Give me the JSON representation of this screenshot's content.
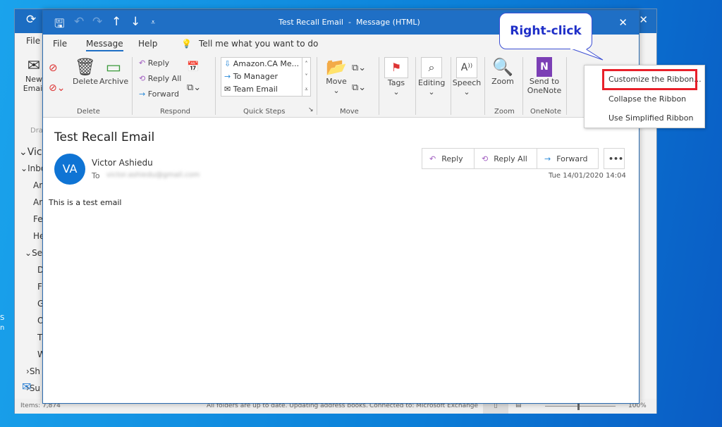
{
  "desktop": {
    "left_fragments": [
      "S",
      "n"
    ]
  },
  "main_window": {
    "tab_file": "File",
    "new_email": "New Email",
    "drafts": "Dra",
    "folders": [
      "Vic",
      "Inbo",
      "An",
      "An",
      "Fe",
      "He",
      "Se",
      "D",
      "F",
      "G",
      "O",
      "T",
      "W",
      "Sh",
      "Su"
    ],
    "status": {
      "items": "Items: 7,874",
      "sync": "All folders are up to date.  Updating address books.",
      "connection": "Connected to: Microsoft Exchange",
      "zoom": "100%"
    }
  },
  "message_window": {
    "title": "Test Recall Email  -  Message (HTML)",
    "tabs": [
      {
        "label": "File"
      },
      {
        "label": "Message",
        "active": true
      },
      {
        "label": "Help"
      }
    ],
    "tell_me": "Tell me what you want to do",
    "ribbon": {
      "delete_group": {
        "label": "Delete",
        "delete": "Delete",
        "archive": "Archive"
      },
      "respond_group": {
        "label": "Respond",
        "reply": "Reply",
        "reply_all": "Reply All",
        "forward": "Forward"
      },
      "quick_steps": {
        "label": "Quick Steps",
        "items": [
          "Amazon.CA Me...",
          "To Manager",
          "Team Email"
        ]
      },
      "move_group": {
        "label": "Move",
        "move": "Move"
      },
      "tags": "Tags",
      "editing": "Editing",
      "speech": "Speech",
      "zoom_group": {
        "label": "Zoom",
        "zoom": "Zoom"
      },
      "onenote_group": {
        "label": "OneNote",
        "send": "Send to OneNote"
      }
    },
    "email": {
      "subject": "Test Recall Email",
      "avatar_initials": "VA",
      "sender": "Victor Ashiedu",
      "to_label": "To",
      "to_address": "victor.ashiedu@gmail.com",
      "date": "Tue 14/01/2020 14:04",
      "body": "This is a test email",
      "actions": {
        "reply": "Reply",
        "reply_all": "Reply All",
        "forward": "Forward",
        "more": "•••"
      }
    }
  },
  "context_menu": {
    "items": [
      "Customize the Ribbon...",
      "Collapse the Ribbon",
      "Use Simplified Ribbon"
    ],
    "highlighted_index": 0
  },
  "callout": {
    "text": "Right-click"
  },
  "colors": {
    "title_bar": "#1f6fc5",
    "highlight_border": "#e8202a",
    "callout_text": "#1f2fc8",
    "avatar": "#0f74d4"
  }
}
